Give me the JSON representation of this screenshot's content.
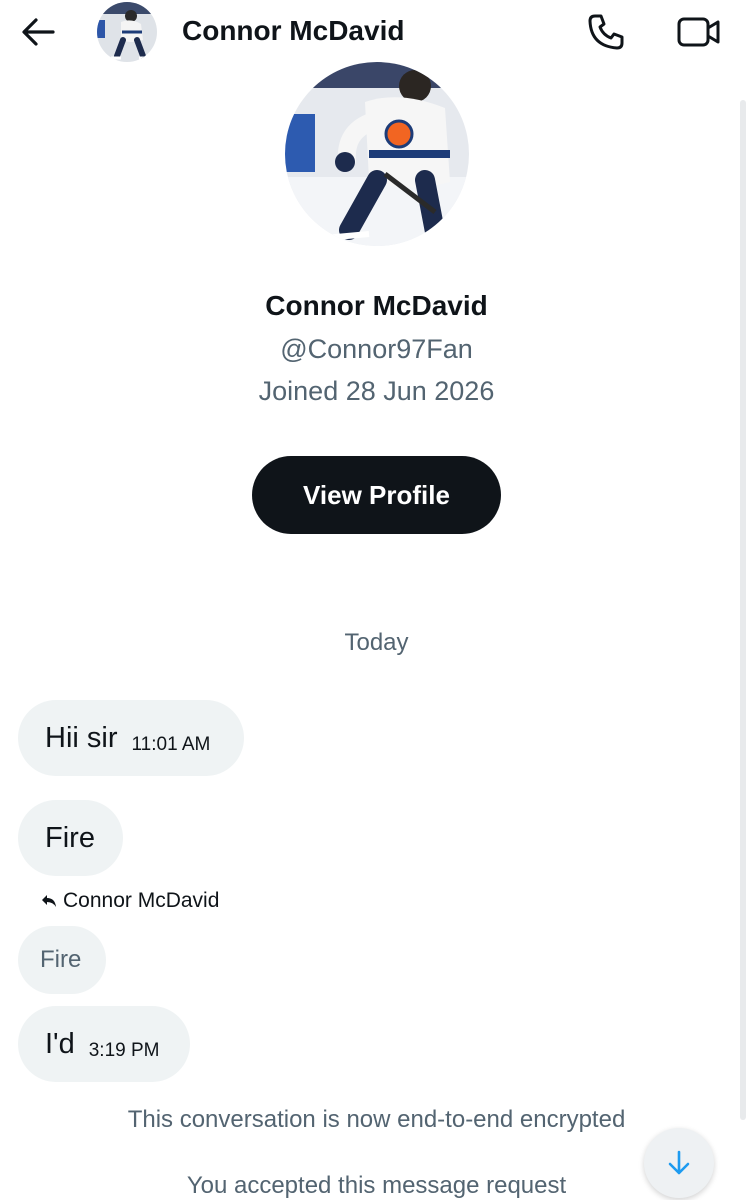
{
  "header": {
    "name": "Connor McDavid"
  },
  "profile": {
    "name": "Connor McDavid",
    "handle": "@Connor97Fan",
    "joined": "Joined 28 Jun 2026",
    "view_profile_label": "View Profile"
  },
  "conversation": {
    "date_separator": "Today",
    "messages": [
      {
        "text": "Hii sir",
        "time": "11:01 AM"
      },
      {
        "text": "Fire"
      },
      {
        "reply_to": "Connor McDavid",
        "quoted": "Fire"
      },
      {
        "text": "I'd",
        "time": "3:19 PM"
      }
    ],
    "system": [
      "This conversation is now end-to-end encrypted",
      "You accepted this message request"
    ]
  },
  "colors": {
    "text": "#0f1419",
    "muted": "#536471",
    "bubble": "#eff3f4",
    "accent": "#1d9bf0",
    "button": "#0f1419"
  },
  "icons": [
    "arrow-left-icon",
    "phone-icon",
    "video-camera-icon",
    "reply-arrow-icon",
    "arrow-down-icon"
  ]
}
